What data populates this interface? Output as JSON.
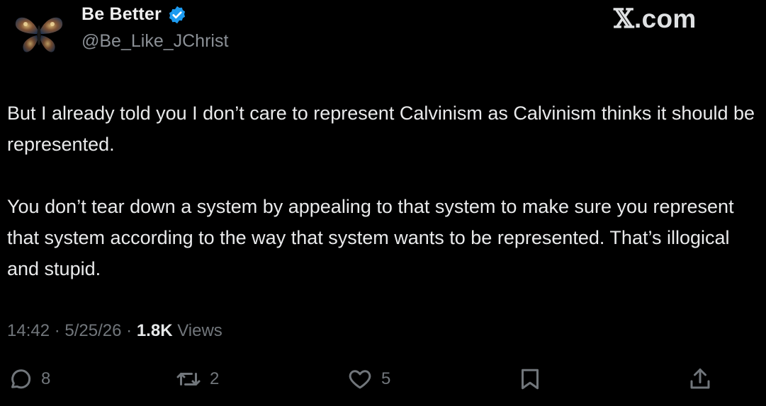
{
  "author": {
    "display_name": "Be Better",
    "handle": "@Be_Like_JChrist",
    "verified": true,
    "avatar_icon": "butterfly-avatar-icon"
  },
  "watermark": {
    "x": "𝕏",
    "domain": ".com"
  },
  "post": {
    "paragraphs": [
      "But I already told you I don’t care to represent Calvinism as Calvinism thinks it should be represented.",
      "You don’t tear down a system by appealing to that system to make sure you represent that system according to the way that system wants to be represented. That’s illogical and stupid."
    ]
  },
  "meta": {
    "time": "14:42",
    "date": "5/25/26",
    "views_count": "1.8K",
    "views_label": "Views",
    "separator": "·"
  },
  "actions": {
    "reply": {
      "icon": "reply-icon",
      "count": "8"
    },
    "repost": {
      "icon": "repost-icon",
      "count": "2"
    },
    "like": {
      "icon": "heart-icon",
      "count": "5"
    },
    "bookmark": {
      "icon": "bookmark-icon"
    },
    "share": {
      "icon": "share-icon"
    }
  },
  "colors": {
    "background": "#000000",
    "text": "#e7e9ea",
    "secondary": "#71767b",
    "verified": "#1d9bf0"
  }
}
